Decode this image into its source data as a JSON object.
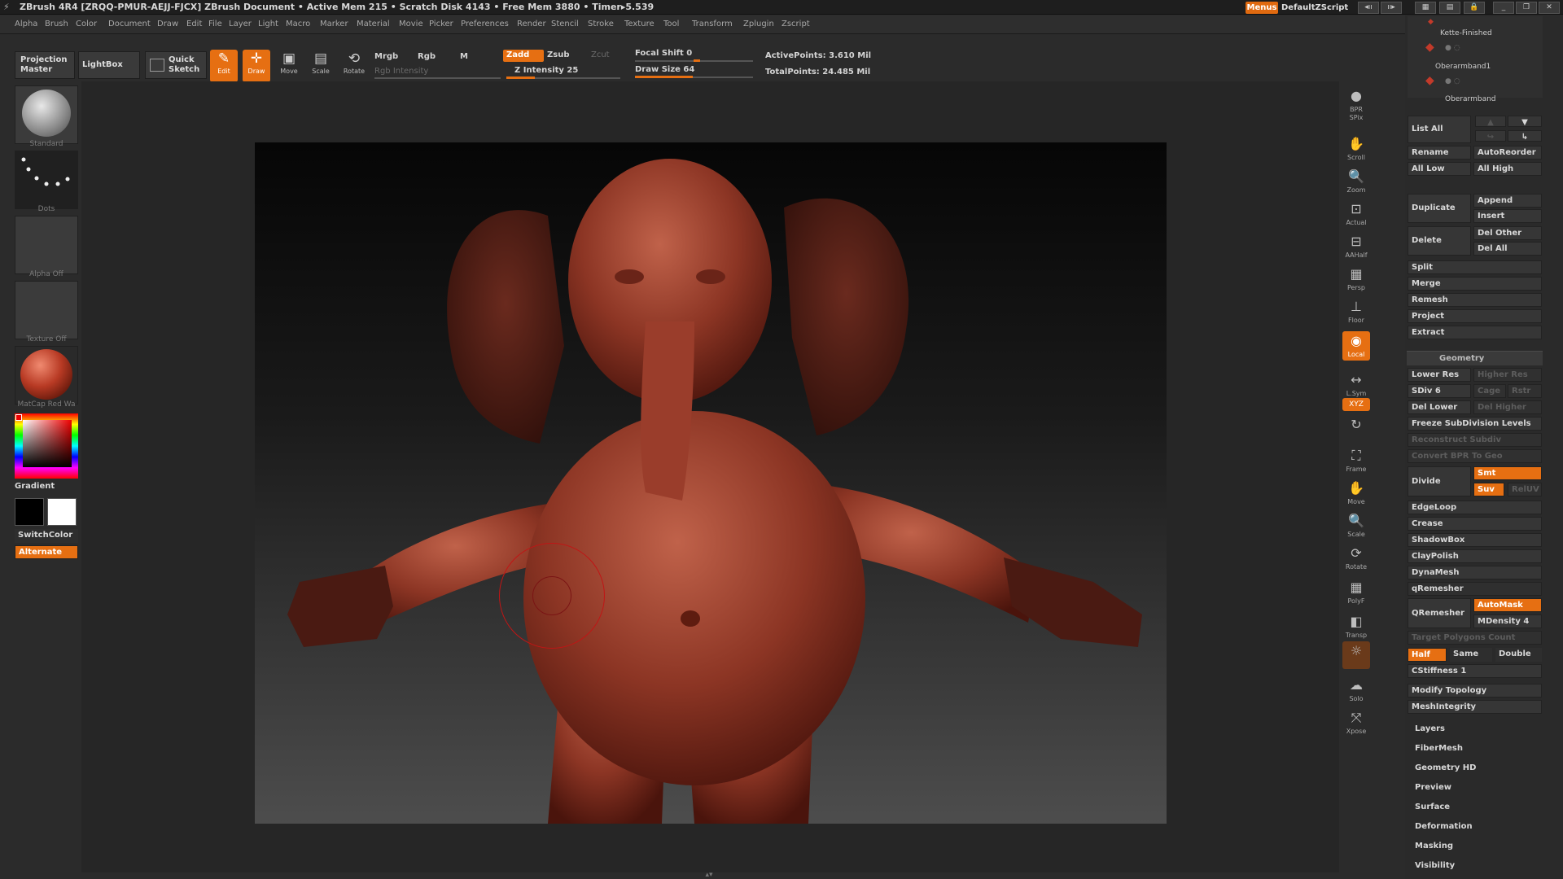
{
  "titlebar": {
    "title": "ZBrush 4R4 [ZRQQ-PMUR-AEJJ-FJCX]   ZBrush Document   • Active Mem 215 • Scratch Disk 4143 • Free Mem 3880 • Timer▸5.539",
    "menus_label": "Menus",
    "script_label": "DefaultZScript"
  },
  "menubar": [
    "Alpha",
    "Brush",
    "Color",
    "Document",
    "Draw",
    "Edit",
    "File",
    "Layer",
    "Light",
    "Macro",
    "Marker",
    "Material",
    "Movie",
    "Picker",
    "Preferences",
    "Render",
    "Stencil",
    "Stroke",
    "Texture",
    "Tool",
    "Transform",
    "Zplugin",
    "Zscript"
  ],
  "shelf": {
    "projection_master": "Projection Master",
    "lightbox": "LightBox",
    "quick_sketch": "Quick Sketch",
    "tools": [
      {
        "label": "Edit",
        "icon": "edit-icon",
        "active": true
      },
      {
        "label": "Draw",
        "icon": "draw-icon",
        "active": true
      },
      {
        "label": "Move",
        "icon": "move-icon",
        "active": false
      },
      {
        "label": "Scale",
        "icon": "scale-icon",
        "active": false
      },
      {
        "label": "Rotate",
        "icon": "rotate-icon",
        "active": false
      }
    ],
    "mrgb": "Mrgb",
    "rgb": "Rgb",
    "m": "M",
    "rgb_intensity": "Rgb Intensity",
    "zadd": "Zadd",
    "zsub": "Zsub",
    "zcut": "Zcut",
    "z_intensity": "Z Intensity 25",
    "focal_shift": "Focal Shift 0",
    "draw_size": "Draw Size 64",
    "active_points": "ActivePoints: 3.610 Mil",
    "total_points": "TotalPoints: 24.485 Mil",
    "z_intensity_value": 25,
    "draw_size_value": 64
  },
  "left_palette": {
    "brush": "Standard",
    "stroke": "Dots",
    "alpha": "Alpha Off",
    "texture": "Texture Off",
    "material": "MatCap Red Wa",
    "gradient": "Gradient",
    "switch_color": "SwitchColor",
    "alternate": "Alternate",
    "colors": {
      "main": "#000000",
      "secondary": "#ffffff",
      "accent": "#e66f12"
    }
  },
  "right_shelf": [
    {
      "label": "BPR",
      "icon": "bpr-icon"
    },
    {
      "label": "SPix",
      "icon": "spix-icon"
    },
    {
      "label": "Scroll",
      "icon": "scroll-icon"
    },
    {
      "label": "Zoom",
      "icon": "zoom-icon"
    },
    {
      "label": "Actual",
      "icon": "actual-icon"
    },
    {
      "label": "AAHalf",
      "icon": "aahalf-icon"
    },
    {
      "label": "Persp",
      "icon": "persp-icon"
    },
    {
      "label": "Floor",
      "icon": "floor-icon"
    },
    {
      "label": "Local",
      "icon": "local-icon"
    },
    {
      "label": "L.Sym",
      "icon": "lsym-icon"
    },
    {
      "label": "XYZ",
      "icon": "xyz-icon"
    },
    {
      "label": "Frame",
      "icon": "frame-icon"
    },
    {
      "label": "Move",
      "icon": "move-icon"
    },
    {
      "label": "Scale",
      "icon": "scale-icon"
    },
    {
      "label": "Rotate",
      "icon": "rotate-icon"
    },
    {
      "label": "PolyF",
      "icon": "polyf-icon"
    },
    {
      "label": "Transp",
      "icon": "transp-icon"
    },
    {
      "label": "Solo",
      "icon": "solo-icon"
    },
    {
      "label": "Xpose",
      "icon": "xpose-icon"
    }
  ],
  "subtool": {
    "items": [
      "Kette-Finished",
      "Oberarmband1",
      "Oberarmband"
    ],
    "list_all": "List All",
    "rename": "Rename",
    "auto_reorder": "AutoReorder",
    "all_low": "All Low",
    "all_high": "All High",
    "duplicate": "Duplicate",
    "append": "Append",
    "insert": "Insert",
    "delete": "Delete",
    "del_other": "Del Other",
    "del_all": "Del All",
    "split": "Split",
    "merge": "Merge",
    "remesh": "Remesh",
    "project": "Project",
    "extract": "Extract"
  },
  "geometry": {
    "title": "Geometry",
    "lower_res": "Lower Res",
    "higher_res": "Higher Res",
    "sdiv": "SDiv 6",
    "cage": "Cage",
    "rstr": "Rstr",
    "del_lower": "Del Lower",
    "del_higher": "Del Higher",
    "freeze": "Freeze SubDivision Levels",
    "reconstruct": "Reconstruct Subdiv",
    "convert_bpr": "Convert BPR To Geo",
    "divide": "Divide",
    "smt": "Smt",
    "suv": "Suv",
    "reluv": "RelUV",
    "edgeloop": "EdgeLoop",
    "crease": "Crease",
    "shadowbox": "ShadowBox",
    "claypolish": "ClayPolish",
    "dynamesh": "DynaMesh",
    "qremesher_head": "qRemesher",
    "qremesher": "QRemesher",
    "automask": "AutoMask",
    "mdensity": "MDensity 4",
    "target_poly": "Target Polygons Count",
    "half": "Half",
    "same": "Same",
    "double": "Double",
    "cstiffness": "CStiffness 1",
    "modify_topology": "Modify Topology",
    "mesh_integrity": "MeshIntegrity"
  },
  "tool_sections": [
    "Layers",
    "FiberMesh",
    "Geometry HD",
    "Preview",
    "Surface",
    "Deformation",
    "Masking",
    "Visibility"
  ]
}
